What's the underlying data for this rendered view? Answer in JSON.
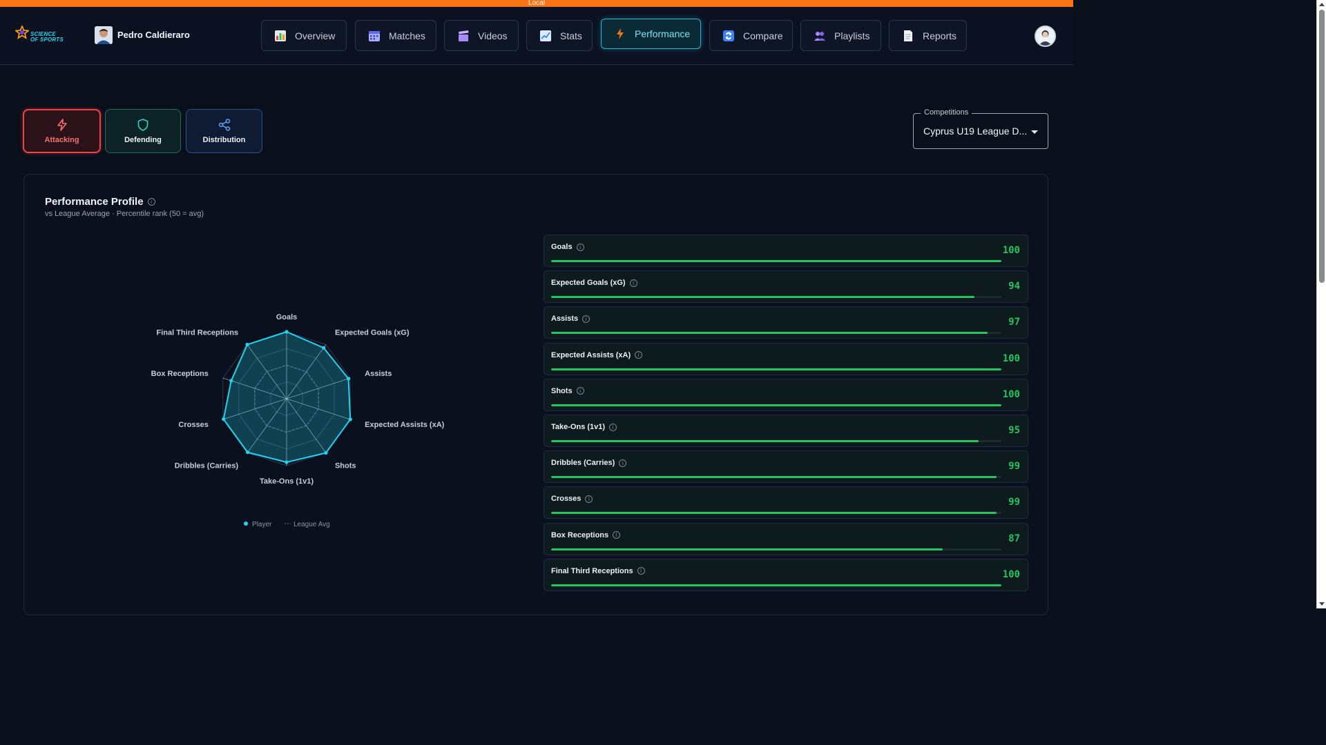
{
  "env": {
    "label": "Local"
  },
  "brand": {
    "logo_text_1": "SCIENCE",
    "logo_text_2": "OF SPORTS"
  },
  "player": {
    "name": "Pedro Caldieraro"
  },
  "nav": [
    {
      "label": "Overview",
      "icon": "overview-icon",
      "color": "#f59e0b"
    },
    {
      "label": "Matches",
      "icon": "calendar-icon",
      "color": "#8b5cf6"
    },
    {
      "label": "Videos",
      "icon": "clapperboard-icon",
      "color": "#a78bfa"
    },
    {
      "label": "Stats",
      "icon": "chart-icon",
      "color": "#60a5fa"
    },
    {
      "label": "Performance",
      "icon": "lightning-icon",
      "color": "#f97316",
      "active": true
    },
    {
      "label": "Compare",
      "icon": "compare-icon",
      "color": "#3b82f6"
    },
    {
      "label": "Playlists",
      "icon": "playlist-icon",
      "color": "#a78bfa"
    },
    {
      "label": "Reports",
      "icon": "report-icon",
      "color": "#e5e7eb"
    }
  ],
  "categories": [
    {
      "label": "Attacking",
      "icon": "lightning-icon",
      "active": true
    },
    {
      "label": "Defending",
      "icon": "shield-icon"
    },
    {
      "label": "Distribution",
      "icon": "share-icon"
    }
  ],
  "competitions": {
    "label": "Competitions",
    "value": "Cyprus U19 League D..."
  },
  "profile": {
    "title": "Performance Profile",
    "subtitle": "vs League Average · Percentile rank (50 = avg)"
  },
  "legend": {
    "player": "Player",
    "league_avg": "League Avg"
  },
  "colors": {
    "accent": "#22d3ee",
    "good": "#22c55e",
    "attacking": "#ef4444"
  },
  "chart_data": {
    "type": "radar",
    "axes": [
      "Goals",
      "Expected Goals (xG)",
      "Assists",
      "Expected Assists (xA)",
      "Shots",
      "Take-Ons (1v1)",
      "Dribbles (Carries)",
      "Crosses",
      "Box Receptions",
      "Final Third Receptions"
    ],
    "range": [
      0,
      100
    ],
    "series": [
      {
        "name": "Player",
        "values": [
          100,
          94,
          97,
          100,
          100,
          95,
          99,
          99,
          87,
          100
        ]
      },
      {
        "name": "League Avg",
        "values": [
          50,
          50,
          50,
          50,
          50,
          50,
          50,
          50,
          50,
          50
        ]
      }
    ]
  },
  "stats": [
    {
      "name": "Goals",
      "value": "100",
      "pct": 100
    },
    {
      "name": "Expected Goals (xG)",
      "value": "94",
      "pct": 94
    },
    {
      "name": "Assists",
      "value": "97",
      "pct": 97
    },
    {
      "name": "Expected Assists (xA)",
      "value": "100",
      "pct": 100
    },
    {
      "name": "Shots",
      "value": "100",
      "pct": 100
    },
    {
      "name": "Take-Ons (1v1)",
      "value": "95",
      "pct": 95
    },
    {
      "name": "Dribbles (Carries)",
      "value": "99",
      "pct": 99
    },
    {
      "name": "Crosses",
      "value": "99",
      "pct": 99
    },
    {
      "name": "Box Receptions",
      "value": "87",
      "pct": 87
    },
    {
      "name": "Final Third Receptions",
      "value": "100",
      "pct": 100
    }
  ]
}
